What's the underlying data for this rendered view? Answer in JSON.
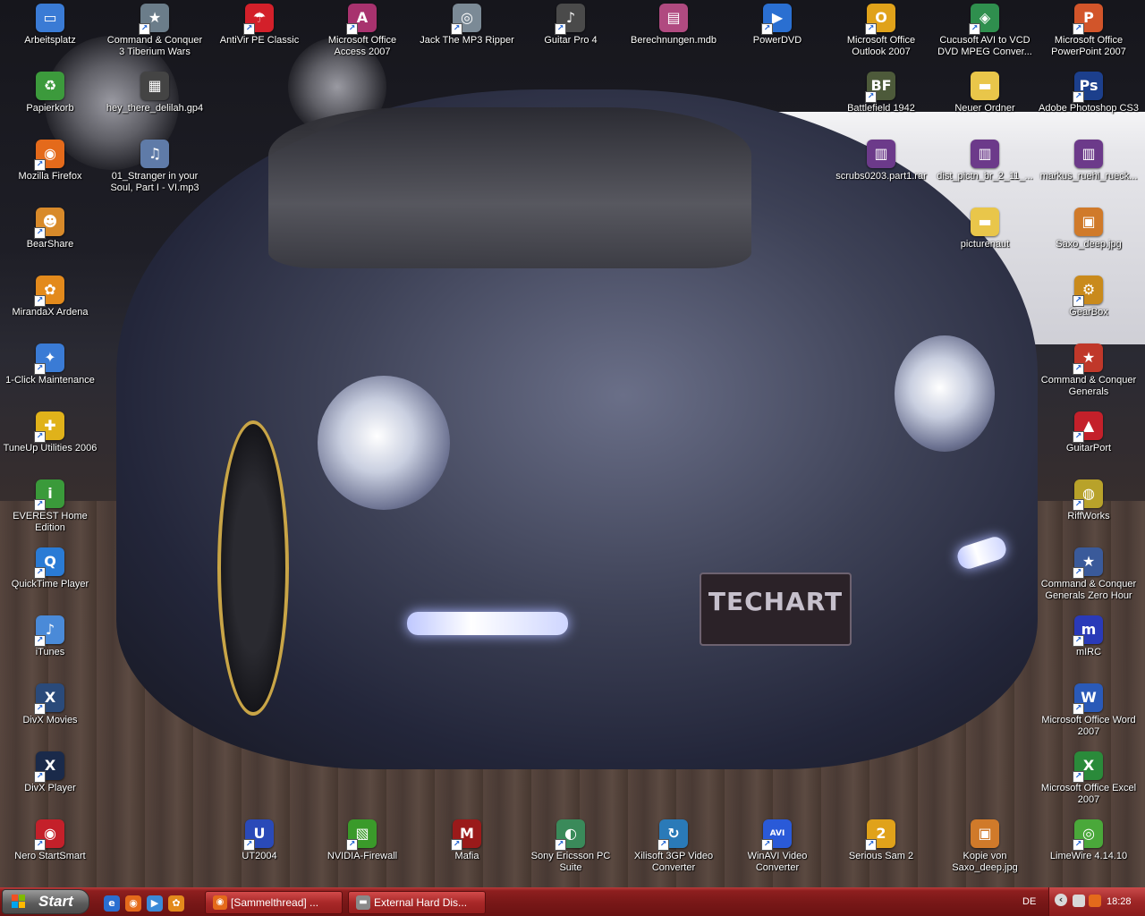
{
  "desktop": {
    "wallpaper_plate": "TECHART",
    "icons": [
      {
        "id": "arbeitsplatz",
        "label": "Arbeitsplatz",
        "icon": "my-computer-icon",
        "color": "#3a7bd5",
        "glyph": "▭"
      },
      {
        "id": "cnc3",
        "label": "Command & Conquer 3 Tiberium Wars",
        "icon": "cnc3-game-icon",
        "color": "#6b7d8a",
        "glyph": "★"
      },
      {
        "id": "antivir",
        "label": "AntiVir PE Classic",
        "icon": "antivir-umbrella-icon",
        "color": "#d3202a",
        "glyph": "☂"
      },
      {
        "id": "access",
        "label": "Microsoft Office Access 2007",
        "icon": "ms-access-icon",
        "color": "#a8326e",
        "glyph": "A"
      },
      {
        "id": "jack",
        "label": "Jack The MP3 Ripper",
        "icon": "cd-ripper-icon",
        "color": "#7b8a96",
        "glyph": "◎"
      },
      {
        "id": "guitarpro",
        "label": "Guitar Pro 4",
        "icon": "guitar-pro-icon",
        "color": "#4a4a4a",
        "glyph": "♪"
      },
      {
        "id": "berechnungen",
        "label": "Berechnungen.mdb",
        "icon": "access-database-file-icon",
        "color": "#b04a80",
        "glyph": "▤"
      },
      {
        "id": "powerdvd",
        "label": "PowerDVD",
        "icon": "powerdvd-icon",
        "color": "#2a6fd1",
        "glyph": "▶"
      },
      {
        "id": "outlook",
        "label": "Microsoft Office Outlook 2007",
        "icon": "ms-outlook-icon",
        "color": "#e0a21a",
        "glyph": "O"
      },
      {
        "id": "cucusoft",
        "label": "Cucusoft AVI to VCD DVD MPEG Conver...",
        "icon": "cucusoft-converter-icon",
        "color": "#2f8f4e",
        "glyph": "◈"
      },
      {
        "id": "powerpoint",
        "label": "Microsoft Office PowerPoint 2007",
        "icon": "ms-powerpoint-icon",
        "color": "#d2552a",
        "glyph": "P"
      },
      {
        "id": "papierkorb",
        "label": "Papierkorb",
        "icon": "recycle-bin-icon",
        "color": "#3c9a3c",
        "glyph": "♻"
      },
      {
        "id": "heythere",
        "label": "hey_there_delilah.gp4",
        "icon": "gp4-file-icon",
        "color": "#444444",
        "glyph": "▦"
      },
      {
        "id": "bf1942",
        "label": "Battlefield 1942",
        "icon": "battlefield-1942-icon",
        "color": "#4d5a3a",
        "glyph": "BF"
      },
      {
        "id": "neuerordner",
        "label": "Neuer Ordner",
        "icon": "folder-icon",
        "color": "#e9c64a",
        "glyph": "▬"
      },
      {
        "id": "photoshop",
        "label": "Adobe Photoshop CS3",
        "icon": "photoshop-icon",
        "color": "#1c3f8c",
        "glyph": "Ps"
      },
      {
        "id": "firefox",
        "label": "Mozilla Firefox",
        "icon": "firefox-icon",
        "color": "#e46a1b",
        "glyph": "◉"
      },
      {
        "id": "stranger",
        "label": "01_Stranger in your Soul, Part I - VI.mp3",
        "icon": "mp3-file-icon",
        "color": "#5f7ba8",
        "glyph": "♫"
      },
      {
        "id": "scrubs",
        "label": "scrubs0203.part1.rar",
        "icon": "rar-archive-icon",
        "color": "#6c3a8a",
        "glyph": "▥"
      },
      {
        "id": "dist",
        "label": "dist_pictn_br_2_11_...",
        "icon": "rar-archive-icon",
        "color": "#6c3a8a",
        "glyph": "▥"
      },
      {
        "id": "markus",
        "label": "markus_ruehl_rueck...",
        "icon": "rar-archive-icon",
        "color": "#6c3a8a",
        "glyph": "▥"
      },
      {
        "id": "bearshare",
        "label": "BearShare",
        "icon": "bearshare-icon",
        "color": "#d88a2a",
        "glyph": "☻"
      },
      {
        "id": "picturenaut",
        "label": "picturenaut",
        "icon": "folder-icon",
        "color": "#e9c64a",
        "glyph": "▬"
      },
      {
        "id": "saxo",
        "label": "Saxo_deep.jpg",
        "icon": "jpg-file-icon",
        "color": "#d07a2a",
        "glyph": "▣"
      },
      {
        "id": "miranda",
        "label": "MirandaX Ardena",
        "icon": "miranda-icon",
        "color": "#e38a1c",
        "glyph": "✿"
      },
      {
        "id": "gearbox",
        "label": "GearBox",
        "icon": "gearbox-icon",
        "color": "#c98a1c",
        "glyph": "⚙"
      },
      {
        "id": "oneclick",
        "label": "1-Click Maintenance",
        "icon": "maintenance-icon",
        "color": "#3a7bd5",
        "glyph": "✦"
      },
      {
        "id": "cncgen",
        "label": "Command & Conquer Generals",
        "icon": "cnc-generals-icon",
        "color": "#c0382a",
        "glyph": "★"
      },
      {
        "id": "tuneup",
        "label": "TuneUp Utilities 2006",
        "icon": "tuneup-icon",
        "color": "#e0b21a",
        "glyph": "✚"
      },
      {
        "id": "guitarport",
        "label": "GuitarPort",
        "icon": "guitarport-icon",
        "color": "#c4202a",
        "glyph": "▲"
      },
      {
        "id": "everest",
        "label": "EVEREST Home Edition",
        "icon": "everest-info-icon",
        "color": "#3a9a3a",
        "glyph": "i"
      },
      {
        "id": "riffworks",
        "label": "RiffWorks",
        "icon": "riffworks-icon",
        "color": "#b8a22a",
        "glyph": "◍"
      },
      {
        "id": "quicktime",
        "label": "QuickTime Player",
        "icon": "quicktime-icon",
        "color": "#2a7bd5",
        "glyph": "Q"
      },
      {
        "id": "cnczh",
        "label": "Command & Conquer Generals Zero Hour",
        "icon": "cnc-zero-hour-icon",
        "color": "#3a5a9a",
        "glyph": "★"
      },
      {
        "id": "itunes",
        "label": "iTunes",
        "icon": "itunes-icon",
        "color": "#4a8ad8",
        "glyph": "♪"
      },
      {
        "id": "mirc",
        "label": "mIRC",
        "icon": "mirc-icon",
        "color": "#2a3ab8",
        "glyph": "m"
      },
      {
        "id": "divxmovies",
        "label": "DivX Movies",
        "icon": "divx-movies-icon",
        "color": "#2a4a7a",
        "glyph": "X"
      },
      {
        "id": "word",
        "label": "Microsoft Office Word 2007",
        "icon": "ms-word-icon",
        "color": "#2a5ab8",
        "glyph": "W"
      },
      {
        "id": "divxplayer",
        "label": "DivX Player",
        "icon": "divx-player-icon",
        "color": "#1a2a4a",
        "glyph": "X"
      },
      {
        "id": "excel",
        "label": "Microsoft Office Excel 2007",
        "icon": "ms-excel-icon",
        "color": "#2a8a3a",
        "glyph": "X"
      },
      {
        "id": "nero",
        "label": "Nero StartSmart",
        "icon": "nero-icon",
        "color": "#c4202a",
        "glyph": "◉"
      },
      {
        "id": "ut2004",
        "label": "UT2004",
        "icon": "ut2004-icon",
        "color": "#2a4ab8",
        "glyph": "U"
      },
      {
        "id": "nvidia",
        "label": "NVIDIA-Firewall",
        "icon": "nvidia-firewall-icon",
        "color": "#3a9a2a",
        "glyph": "▧"
      },
      {
        "id": "mafia",
        "label": "Mafia",
        "icon": "mafia-game-icon",
        "color": "#9a1a1a",
        "glyph": "M"
      },
      {
        "id": "sonyericsson",
        "label": "Sony Ericsson PC Suite",
        "icon": "sony-ericsson-icon",
        "color": "#3a8a5a",
        "glyph": "◐"
      },
      {
        "id": "xilisoft",
        "label": "Xilisoft 3GP Video Converter",
        "icon": "xilisoft-icon",
        "color": "#2a7ab8",
        "glyph": "↻"
      },
      {
        "id": "winavi",
        "label": "WinAVI Video Converter",
        "icon": "winavi-icon",
        "color": "#2a5ad8",
        "glyph": "AVI"
      },
      {
        "id": "serioussam",
        "label": "Serious Sam 2",
        "icon": "serious-sam-icon",
        "color": "#e0a21a",
        "glyph": "2"
      },
      {
        "id": "kopiesaxo",
        "label": "Kopie von Saxo_deep.jpg",
        "icon": "jpg-file-icon",
        "color": "#d07a2a",
        "glyph": "▣"
      },
      {
        "id": "limewire",
        "label": "LimeWire 4.14.10",
        "icon": "limewire-icon",
        "color": "#4aa83a",
        "glyph": "◎"
      }
    ]
  },
  "taskbar": {
    "start_label": "Start",
    "quick_launch": [
      {
        "icon": "ie-icon",
        "color": "#2a6fd1",
        "glyph": "e"
      },
      {
        "icon": "firefox-icon",
        "color": "#e46a1b",
        "glyph": "◉"
      },
      {
        "icon": "media-icon",
        "color": "#3a8ad8",
        "glyph": "▶"
      },
      {
        "icon": "miranda-icon",
        "color": "#e38a1c",
        "glyph": "✿"
      }
    ],
    "tasks": [
      {
        "label": "[Sammelthread] ...",
        "icon": "firefox-icon",
        "color": "#e46a1b",
        "glyph": "◉"
      },
      {
        "label": "External Hard Dis...",
        "icon": "drive-icon",
        "color": "#8a8a8a",
        "glyph": "▬"
      }
    ],
    "language": "DE",
    "clock": "18:28"
  }
}
